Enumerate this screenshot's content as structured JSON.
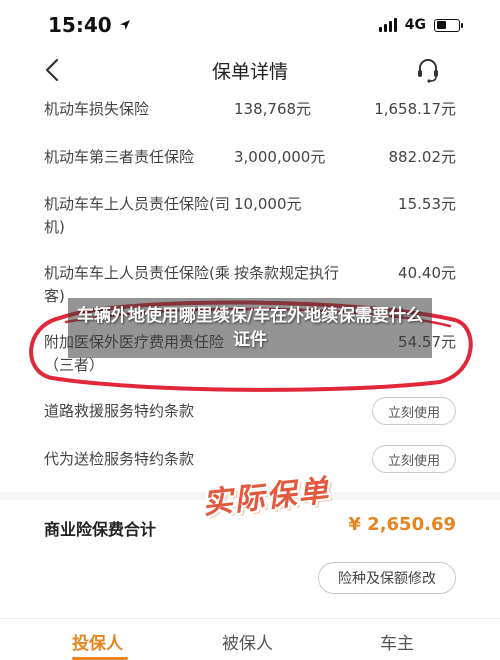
{
  "status_bar": {
    "time": "15:40",
    "network": "4G"
  },
  "nav": {
    "title": "保单详情"
  },
  "rows": [
    {
      "name": "机动车损失保险",
      "amount": "138,768元",
      "premium": "1,658.17元"
    },
    {
      "name": "机动车第三者责任保险",
      "amount": "3,000,000元",
      "premium": "882.02元"
    },
    {
      "name": "机动车车上人员责任保险(司机)",
      "amount": "10,000元",
      "premium": "15.53元"
    },
    {
      "name": "机动车车上人员责任保险(乘客)",
      "amount": "按条款规定执行",
      "premium": "40.40元"
    },
    {
      "name": "附加医保外医疗费用责任险（三者）",
      "amount": "",
      "premium": "54.57元"
    }
  ],
  "services": [
    {
      "name": "道路救援服务特约条款",
      "button": "立刻使用"
    },
    {
      "name": "代为送检服务特约条款",
      "button": "立刻使用"
    }
  ],
  "total": {
    "label": "商业险保费合计",
    "value": "¥ 2,650.69",
    "modify_button": "险种及保额修改"
  },
  "tabs": [
    {
      "label": "投保人",
      "active": true
    },
    {
      "label": "被保人",
      "active": false
    },
    {
      "label": "车主",
      "active": false
    }
  ],
  "overlay": {
    "banner_text": "车辆外地使用哪里续保/车在外地续保需要什么证件",
    "stamp_text": "实际保单"
  },
  "colors": {
    "accent": "#e8841f",
    "annotation_red": "#e0283a"
  }
}
